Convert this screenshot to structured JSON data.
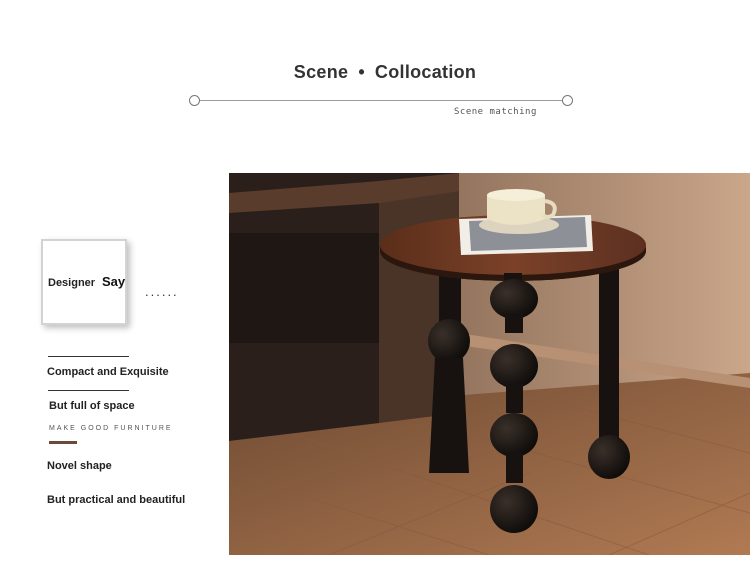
{
  "section": {
    "title_left": "Scene",
    "separator": "•",
    "title_right": "Collocation",
    "subtitle": "Scene matching"
  },
  "designer": {
    "label": "Designer",
    "say": "Say",
    "ellipsis": "......"
  },
  "features": {
    "line1": "Compact and Exquisite",
    "line2": "But full of space",
    "tagline": "MAKE GOOD FURNITURE",
    "line3": "Novel shape",
    "line4": "But practical and beautiful"
  },
  "colors": {
    "accent_brown": "#6b4a3a",
    "table_top": "#6e3a22",
    "legs": "#1a1512"
  }
}
